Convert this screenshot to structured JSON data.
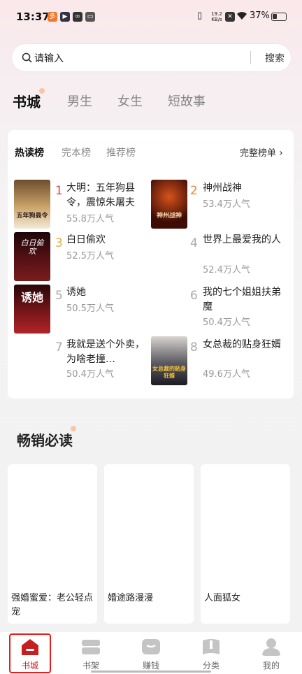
{
  "status_bar": {
    "time": "13:37",
    "net_speed_value": "19.2",
    "net_speed_unit": "KB/s",
    "battery": "37%"
  },
  "search": {
    "placeholder": "请输入",
    "button": "搜索"
  },
  "channel_tabs": [
    {
      "label": "书城",
      "active": true
    },
    {
      "label": "男生",
      "active": false
    },
    {
      "label": "女生",
      "active": false
    },
    {
      "label": "短故事",
      "active": false
    }
  ],
  "ranking": {
    "tabs": [
      {
        "label": "热读榜",
        "active": true
      },
      {
        "label": "完本榜",
        "active": false
      },
      {
        "label": "推荐榜",
        "active": false
      }
    ],
    "more_label": "完整榜单",
    "books": [
      {
        "rank": "1",
        "title": "大明：五年狗县令，震惊朱屠夫",
        "popularity": "55.8万人气",
        "cover_text": "五年狗县令",
        "cover": "#8a6a3c"
      },
      {
        "rank": "2",
        "title": "神州战神",
        "popularity": "53.4万人气",
        "cover_text": "神州战神",
        "cover": "#5a1d0c"
      },
      {
        "rank": "3",
        "title": "白日偷欢",
        "popularity": "52.5万人气",
        "cover_text": "白日偷欢",
        "cover": "#3a0e10"
      },
      {
        "rank": "4",
        "title": "世界上最爱我的人",
        "popularity": "52.4万人气",
        "cover_text": "",
        "cover": ""
      },
      {
        "rank": "5",
        "title": "诱她",
        "popularity": "50.5万人气",
        "cover_text": "诱她",
        "cover": "#6a1418"
      },
      {
        "rank": "6",
        "title": "我的七个姐姐扶弟魔",
        "popularity": "50.4万人气",
        "cover_text": "",
        "cover": ""
      },
      {
        "rank": "7",
        "title": "我就是送个外卖，为啥老撞…",
        "popularity": "50.4万人气",
        "cover_text": "",
        "cover": ""
      },
      {
        "rank": "8",
        "title": "女总裁的贴身狂婿",
        "popularity": "49.6万人气",
        "cover_text": "女总裁的贴身狂婿",
        "cover": "#2b2b33"
      }
    ]
  },
  "bestsellers": {
    "title": "畅销必读",
    "books": [
      {
        "title": "强婚蜜爱：老公轻点宠"
      },
      {
        "title": "婚途路漫漫"
      },
      {
        "title": "人面狐女"
      }
    ]
  },
  "bottom_nav": [
    {
      "label": "书城",
      "icon": "home-icon",
      "active": true
    },
    {
      "label": "书架",
      "icon": "bookshelf-icon",
      "active": false
    },
    {
      "label": "赚钱",
      "icon": "wallet-icon",
      "active": false
    },
    {
      "label": "分类",
      "icon": "category-icon",
      "active": false
    },
    {
      "label": "我的",
      "icon": "profile-icon",
      "active": false
    }
  ],
  "colors": {
    "accent": "#c71f1f",
    "rank1": "#e04848",
    "rank2": "#e8893a",
    "rank3": "#e2b23a"
  }
}
